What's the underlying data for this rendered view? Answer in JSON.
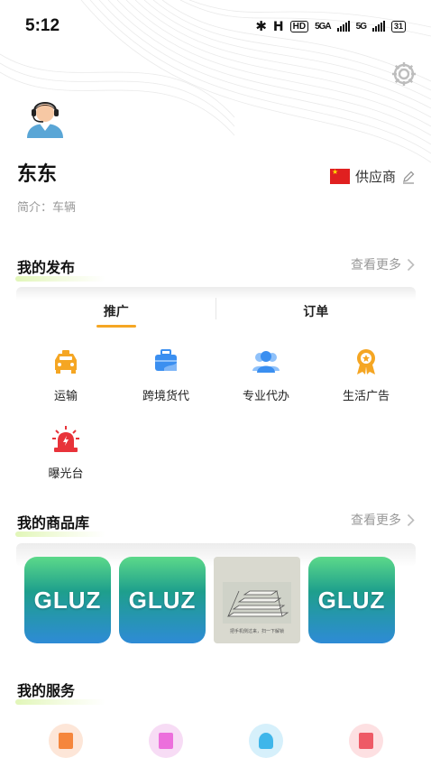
{
  "status": {
    "time": "5:12",
    "hd": "HD",
    "net1": "5GA",
    "net2": "5G",
    "battery": "31"
  },
  "profile": {
    "name": "东东",
    "intro": "简介：车辆",
    "role": "供应商"
  },
  "publish": {
    "title": "我的发布",
    "more": "查看更多",
    "tabs": [
      "推广",
      "订单"
    ],
    "categories": [
      {
        "label": "运输",
        "icon": "taxi-icon",
        "color": "#f5a623"
      },
      {
        "label": "跨境货代",
        "icon": "briefcase-icon",
        "color": "#3b8ff0"
      },
      {
        "label": "专业代办",
        "icon": "group-icon",
        "color": "#3b8ff0"
      },
      {
        "label": "生活广告",
        "icon": "badge-icon",
        "color": "#f5a623"
      },
      {
        "label": "曝光台",
        "icon": "alarm-icon",
        "color": "#e8333a"
      }
    ]
  },
  "goods": {
    "title": "我的商品库",
    "more": "查看更多",
    "items": [
      "GLUZ",
      "GLUZ",
      "把手机侧过来，扫一下解锁",
      "GLUZ"
    ]
  },
  "services": {
    "title": "我的服务"
  }
}
